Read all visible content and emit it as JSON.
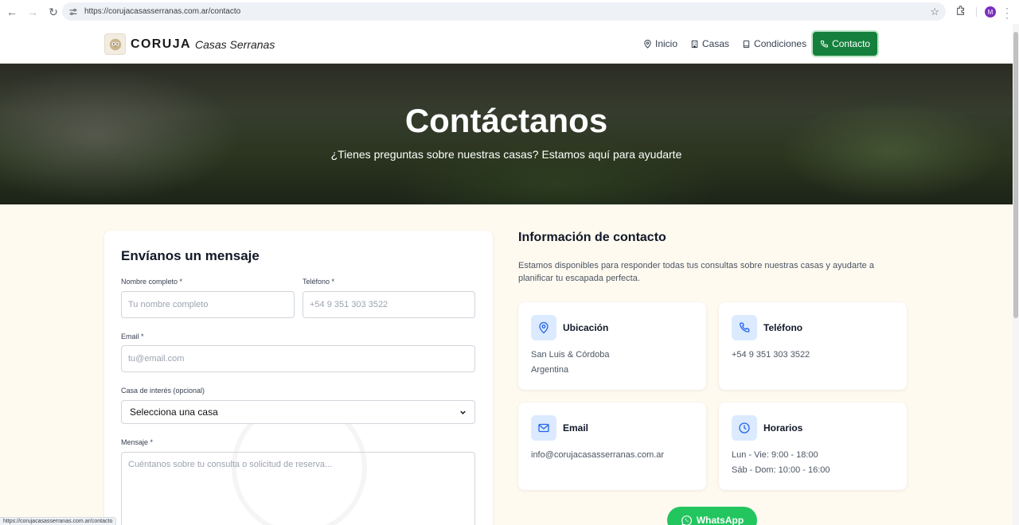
{
  "browser": {
    "url": "https://corujacasasserranas.com.ar/contacto",
    "profile_initial": "M",
    "status_url": "https://corujacasasserranas.com.ar/contacto"
  },
  "header": {
    "brand_strong": "CORUJA",
    "brand_sub": "Casas Serranas",
    "menu": [
      {
        "label": "Inicio",
        "icon": "map-pin-icon"
      },
      {
        "label": "Casas",
        "icon": "building-icon"
      },
      {
        "label": "Condiciones",
        "icon": "document-icon"
      },
      {
        "label": "Contacto",
        "icon": "phone-icon",
        "active": true
      }
    ]
  },
  "hero": {
    "title": "Contáctanos",
    "subtitle": "¿Tienes preguntas sobre nuestras casas? Estamos aquí para ayudarte"
  },
  "form": {
    "title": "Envíanos un mensaje",
    "name_label": "Nombre completo *",
    "name_placeholder": "Tu nombre completo",
    "phone_label": "Teléfono *",
    "phone_placeholder": "+54 9 351 303 3522",
    "email_label": "Email *",
    "email_placeholder": "tu@email.com",
    "house_label": "Casa de interés (opcional)",
    "house_value": "Selecciona una casa",
    "message_label": "Mensaje *",
    "message_placeholder": "Cuéntanos sobre tu consulta o solicitud de reserva..."
  },
  "contact_info": {
    "title": "Información de contacto",
    "description": "Estamos disponibles para responder todas tus consultas sobre nuestras casas y ayudarte a planificar tu escapada perfecta.",
    "cards": {
      "location": {
        "title": "Ubicación",
        "line1": "San Luis & Córdoba",
        "line2": "Argentina"
      },
      "phone": {
        "title": "Teléfono",
        "line1": "+54 9 351 303 3522"
      },
      "email": {
        "title": "Email",
        "line1": "info@corujacasasserranas.com.ar"
      },
      "hours": {
        "title": "Horarios",
        "line1": "Lun - Vie: 9:00 - 18:00",
        "line2": "Sáb - Dom: 10:00 - 16:00"
      }
    }
  },
  "whatsapp": {
    "label": "WhatsApp"
  },
  "colors": {
    "accent_green": "#15803d",
    "whatsapp_green": "#22c55e",
    "icon_blue": "#2563eb",
    "icon_bg": "#dbeafe",
    "page_bg": "#fffaf0"
  }
}
